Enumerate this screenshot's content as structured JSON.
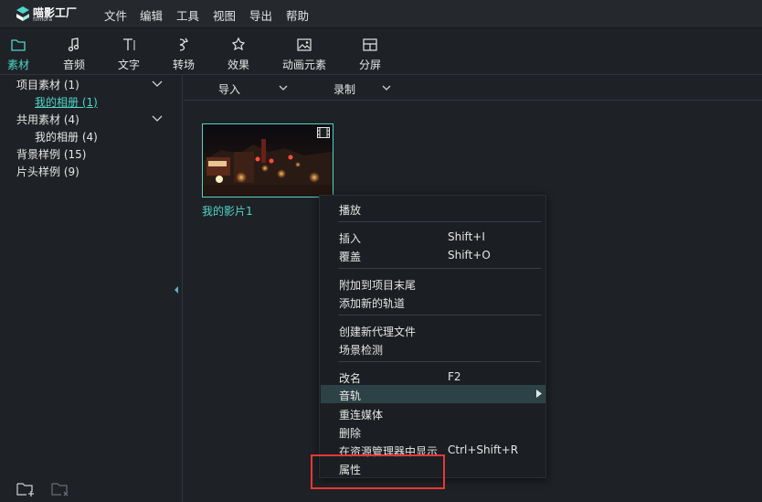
{
  "app": {
    "logo_name": "喵影工厂",
    "logo_sub": "filmora",
    "brand_color": "#4ed6c9"
  },
  "menubar": {
    "items": [
      "文件",
      "编辑",
      "工具",
      "视图",
      "导出",
      "帮助"
    ]
  },
  "toolbar": {
    "tools": [
      {
        "label": "素材",
        "icon": "folder-icon",
        "active": true
      },
      {
        "label": "音频",
        "icon": "music-note-icon",
        "active": false
      },
      {
        "label": "文字",
        "icon": "text-icon",
        "active": false
      },
      {
        "label": "转场",
        "icon": "transition-icon",
        "active": false
      },
      {
        "label": "效果",
        "icon": "effects-icon",
        "active": false
      },
      {
        "label": "动画元素",
        "icon": "image-icon",
        "active": false
      },
      {
        "label": "分屏",
        "icon": "split-screen-icon",
        "active": false
      }
    ]
  },
  "sidebar": {
    "tree": [
      {
        "label": "项目素材 (1)",
        "expanded": true
      },
      {
        "label": "我的相册 (1)",
        "selected": true
      },
      {
        "label": "共用素材 (4)",
        "expanded": true
      },
      {
        "label": "我的相册 (4)"
      },
      {
        "label": "背景样例 (15)"
      },
      {
        "label": "片头样例 (9)"
      }
    ],
    "bottom_icons": [
      "add-folder-icon",
      "delete-folder-icon"
    ]
  },
  "main": {
    "import_label": "导入",
    "record_label": "录制",
    "media": [
      {
        "caption": "我的影片1",
        "selected": true
      }
    ]
  },
  "context_menu": {
    "items": [
      {
        "label": "播放",
        "shortcut": ""
      },
      {
        "label": "插入",
        "shortcut": "Shift+I"
      },
      {
        "label": "覆盖",
        "shortcut": "Shift+O"
      },
      {
        "label": "附加到项目末尾",
        "shortcut": ""
      },
      {
        "label": "添加新的轨道",
        "shortcut": ""
      },
      {
        "label": "创建新代理文件",
        "shortcut": ""
      },
      {
        "label": "场景检测",
        "shortcut": ""
      },
      {
        "label": "改名",
        "shortcut": "F2"
      },
      {
        "label": "音轨",
        "shortcut": "",
        "submenu": true,
        "hovered": true
      },
      {
        "label": "重连媒体",
        "shortcut": ""
      },
      {
        "label": "删除",
        "shortcut": ""
      },
      {
        "label": "在资源管理器中显示",
        "shortcut": "Ctrl+Shift+R"
      },
      {
        "label": "属性",
        "shortcut": ""
      }
    ]
  },
  "annotation": {
    "highlight_color": "#e53935"
  }
}
